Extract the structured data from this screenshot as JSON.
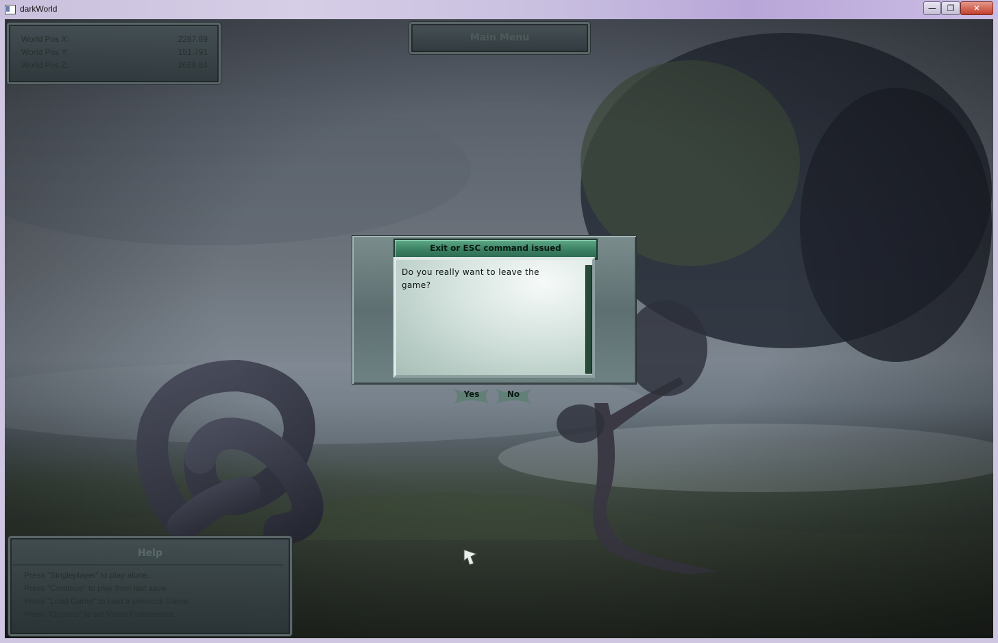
{
  "window": {
    "title": "darkWorld",
    "minimize": "—",
    "maximize": "❐",
    "close": "✕"
  },
  "hud": {
    "position": [
      {
        "label": "World Pos X:",
        "value": "2287.89"
      },
      {
        "label": "World Pos Y:",
        "value": "151.791"
      },
      {
        "label": "World Pos Z:",
        "value": "2669.84"
      }
    ],
    "main_menu": "Main Menu",
    "help": {
      "title": "Help",
      "lines": [
        "Press \"Singleplayer\" to play alone.",
        "Press \"Continue\" to play from last save.",
        "Press \"Load Game\" to load a previous Game.",
        "Press \"Options\" to set Video Preferences."
      ]
    }
  },
  "dialog": {
    "title": "Exit or ESC command issued",
    "message": "Do you really want to leave the game?",
    "yes": "Yes",
    "no": "No"
  },
  "colors": {
    "dialog_title": "#3a7f62",
    "panel": "#46525a"
  }
}
